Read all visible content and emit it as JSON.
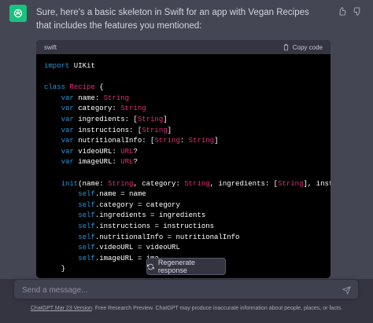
{
  "message": {
    "text": "Sure, here's a basic skeleton in Swift for an app with Vegan Recipes that includes the features you mentioned:"
  },
  "code_block": {
    "language": "swift",
    "copy_label": "Copy code"
  },
  "regenerate_label": "Regenerate response",
  "composer": {
    "placeholder": "Send a message..."
  },
  "footer": {
    "version_link": "ChatGPT Mar 23 Version",
    "disclaimer": ". Free Research Preview. ChatGPT may produce inaccurate information about people, places, or facts."
  },
  "icons": {
    "avatar": "openai-logo-icon",
    "thumbs_up": "thumbs-up-icon",
    "thumbs_down": "thumbs-down-icon",
    "copy": "clipboard-icon",
    "regenerate": "refresh-icon",
    "send": "paper-plane-icon"
  },
  "colors": {
    "background": "#444654",
    "avatar": "#19c37d",
    "keyword": "#2e95d3",
    "type": "#df3079"
  }
}
